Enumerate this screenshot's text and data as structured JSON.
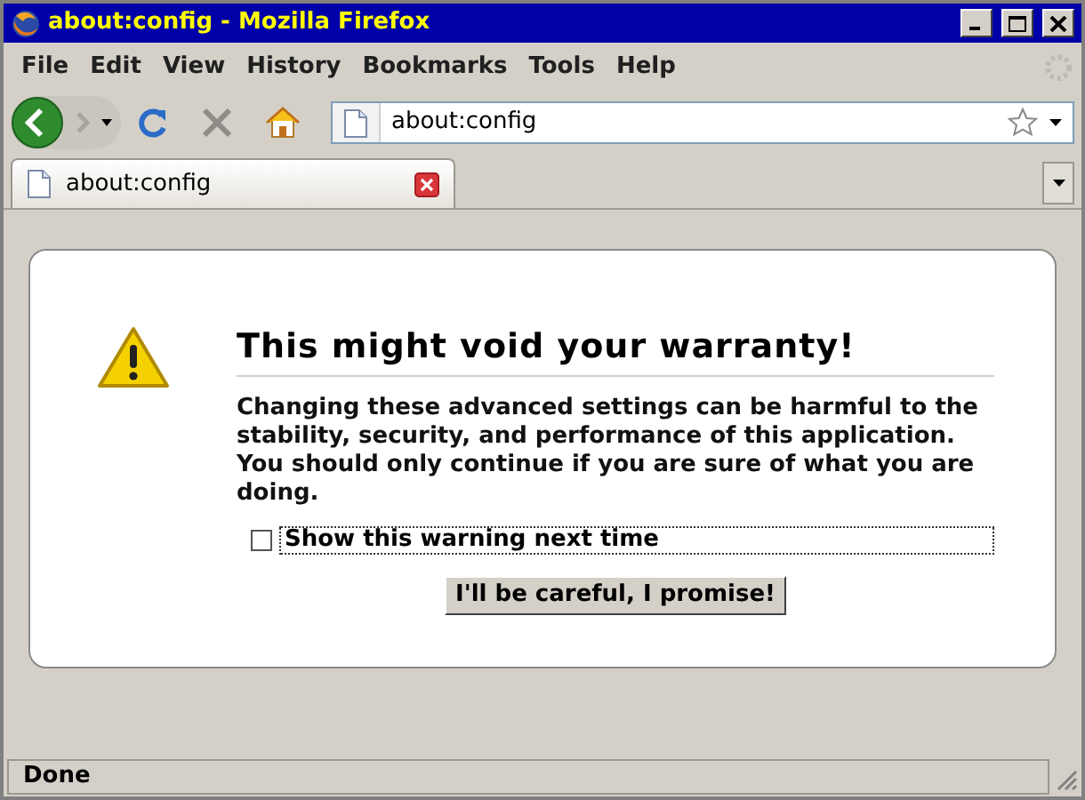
{
  "window": {
    "title": "about:config - Mozilla Firefox"
  },
  "menu": [
    "File",
    "Edit",
    "View",
    "History",
    "Bookmarks",
    "Tools",
    "Help"
  ],
  "address_bar": {
    "value": "about:config"
  },
  "tabs": [
    {
      "label": "about:config",
      "selected": true
    }
  ],
  "warning": {
    "title": "This might void your warranty!",
    "message": "Changing these advanced settings can be harmful to the stability, security, and performance of this application. You should only continue if you are sure of what you are doing.",
    "checkbox": {
      "label": "Show this warning next time",
      "checked": false
    },
    "button": "I'll be careful, I promise!"
  },
  "status_bar": {
    "text": "Done"
  }
}
